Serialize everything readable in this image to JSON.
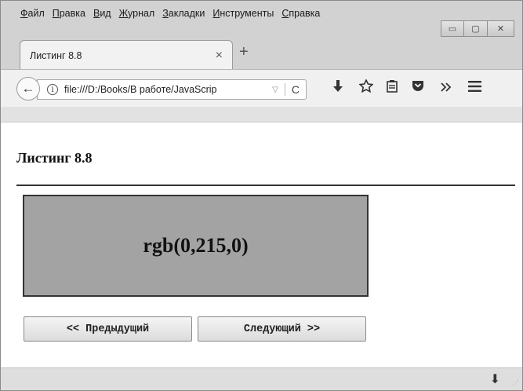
{
  "menu": [
    {
      "first": "Ф",
      "rest": "айл"
    },
    {
      "first": "П",
      "rest": "равка"
    },
    {
      "first": "В",
      "rest": "ид"
    },
    {
      "first": "Ж",
      "rest": "урнал"
    },
    {
      "first": "З",
      "rest": "акладки"
    },
    {
      "first": "И",
      "rest": "нструменты"
    },
    {
      "first": "С",
      "rest": "правка"
    }
  ],
  "window_controls": {
    "minimize": "▭",
    "maximize": "▢",
    "close": "✕"
  },
  "tab": {
    "title": "Листинг 8.8",
    "close": "×",
    "new_tab": "+"
  },
  "navbar": {
    "back": "←",
    "info": "i",
    "url": "file:///D:/Books/В работе/JavaScrip",
    "url_dropdown": "▽",
    "reload": "C",
    "icons": [
      "download-icon",
      "bookmark-star-icon",
      "reader-view-icon",
      "pocket-icon",
      "overflow-icon",
      "menu-icon"
    ]
  },
  "page": {
    "heading": "Листинг 8.8",
    "color_value": "rgb(0,215,0)",
    "prev_button": "<< Предыдущий",
    "next_button": "Следующий >>"
  },
  "statusbar": {
    "download": "⬇"
  }
}
